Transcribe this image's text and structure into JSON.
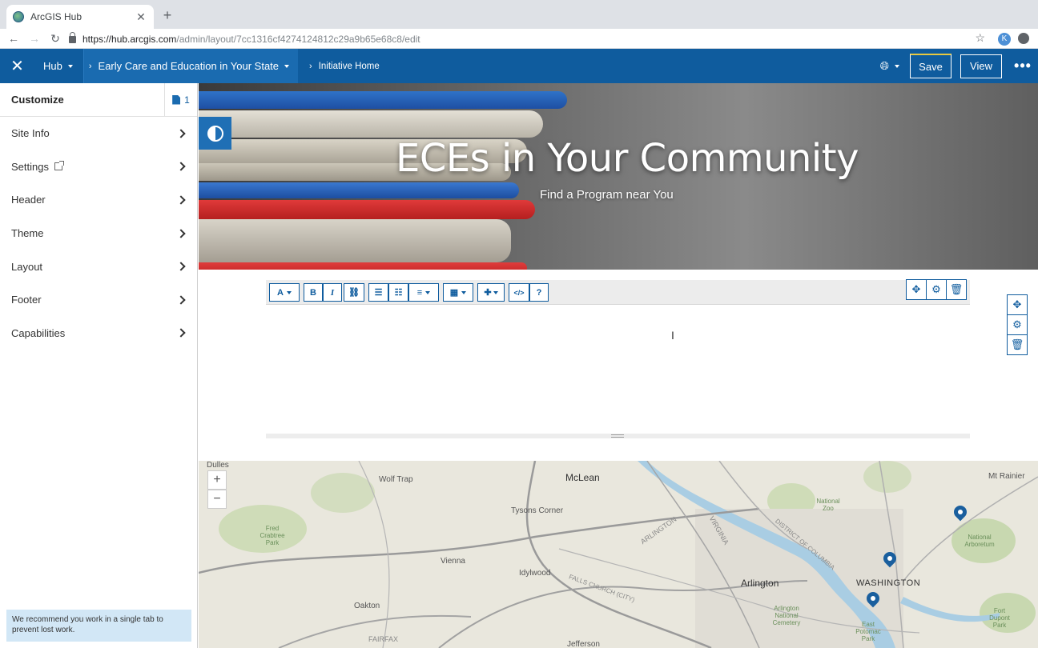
{
  "browser": {
    "tab_title": "ArcGIS Hub",
    "tab_close": "✕",
    "new_tab": "+",
    "url_host": "https://hub.arcgis.com",
    "url_path": "/admin/layout/7cc1316cf4274124812c29a9b65e68c8/edit",
    "profile_initial": "K"
  },
  "header": {
    "close": "✕",
    "hub_label": "Hub",
    "site_label": "Early Care and Education in Your State",
    "page_label": "Initiative Home",
    "save_label": "Save",
    "view_label": "View",
    "more_label": "•••"
  },
  "sidebar": {
    "title": "Customize",
    "page_count": "1",
    "items": [
      {
        "label": "Site Info"
      },
      {
        "label": "Settings"
      },
      {
        "label": "Header"
      },
      {
        "label": "Theme"
      },
      {
        "label": "Layout"
      },
      {
        "label": "Footer"
      },
      {
        "label": "Capabilities"
      }
    ],
    "note": "We recommend you work in a single tab to prevent lost work."
  },
  "hero": {
    "title": "ECEs in Your Community",
    "subtitle": "Find a Program near You"
  },
  "editor_toolbar": {
    "font": "A",
    "bold": "B",
    "italic": "I",
    "link": "⛓",
    "bullets": "☰",
    "numbers": "☷",
    "align": "≡",
    "table": "▦",
    "insert": "✚",
    "code": "</>",
    "help": "?"
  },
  "row_controls": {
    "move": "✥",
    "settings": "⚙",
    "delete": "🗑"
  },
  "map": {
    "zoom_in": "+",
    "zoom_out": "−",
    "labels": {
      "mclean": "McLean",
      "wolf_trap": "Wolf Trap",
      "tysons": "Tysons Corner",
      "vienna": "Vienna",
      "idylwood": "Idylwood",
      "oakton": "Oakton",
      "arlington_city": "Arlington",
      "arlington_road": "ARLINGTON",
      "washington": "WASHINGTON",
      "fairfax": "FAIRFAX",
      "jefferson": "Jefferson",
      "falls_church": "FALLS CHURCH (CITY)",
      "virginia": "VIRGINIA",
      "district": "DISTRICT OF COLUMBIA",
      "mt_rainier": "Mt Rainier",
      "dulles": "Dulles",
      "fred_crabtree": "Fred Crabtree Park",
      "national_zoo": "National Zoo",
      "national_arboretum": "National Arboretum",
      "arlington_cemetery": "Arlington National Cemetery",
      "east_potomac": "East Potomac Park",
      "fort_dupont": "Fort Dupont Park"
    }
  }
}
